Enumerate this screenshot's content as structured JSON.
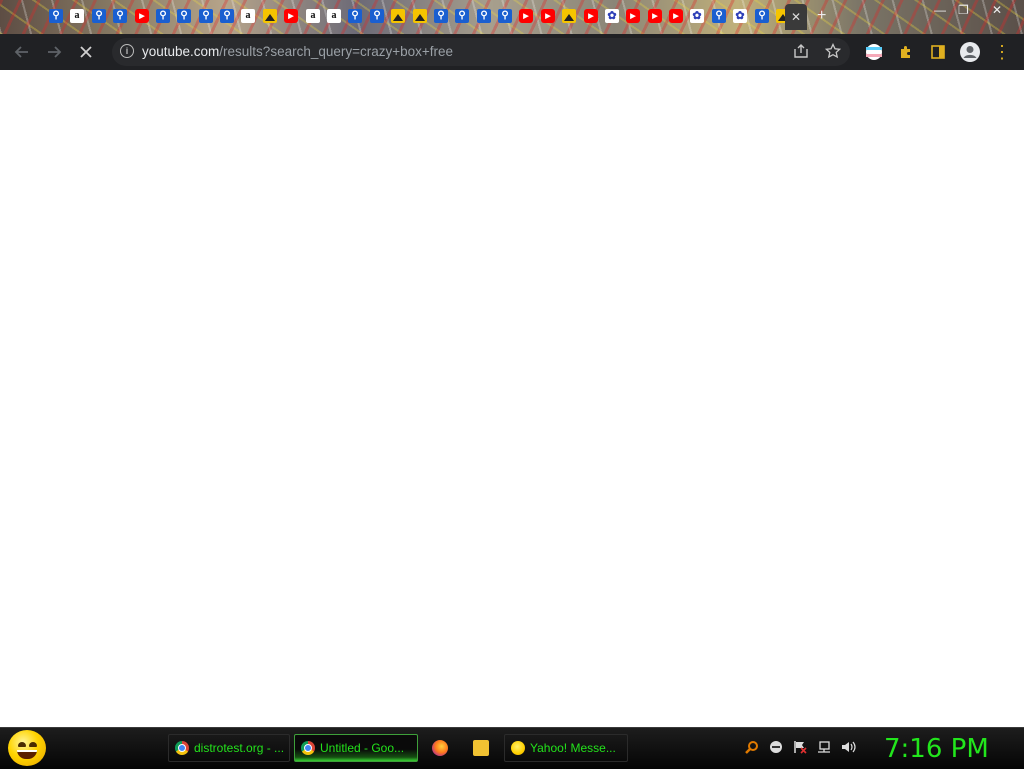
{
  "browser": {
    "url_host": "youtube.com",
    "url_path": "/results?search_query=crazy+box+free",
    "tabs": [
      {
        "icon": "search-icon"
      },
      {
        "icon": "amazon-icon",
        "glyph": "a"
      },
      {
        "icon": "search-icon"
      },
      {
        "icon": "search-icon"
      },
      {
        "icon": "youtube-icon"
      },
      {
        "icon": "search-icon"
      },
      {
        "icon": "search-icon"
      },
      {
        "icon": "search-icon"
      },
      {
        "icon": "search-icon"
      },
      {
        "icon": "amazon-icon",
        "glyph": "a"
      },
      {
        "icon": "image-icon"
      },
      {
        "icon": "youtube-icon"
      },
      {
        "icon": "amazon-icon",
        "glyph": "a"
      },
      {
        "icon": "amazon-icon",
        "glyph": "a"
      },
      {
        "icon": "search-icon"
      },
      {
        "icon": "search-icon"
      },
      {
        "icon": "image-icon"
      },
      {
        "icon": "image-icon"
      },
      {
        "icon": "search-icon"
      },
      {
        "icon": "search-icon"
      },
      {
        "icon": "search-icon"
      },
      {
        "icon": "search-icon"
      },
      {
        "icon": "youtube-icon"
      },
      {
        "icon": "youtube-icon"
      },
      {
        "icon": "image-icon"
      },
      {
        "icon": "youtube-icon"
      },
      {
        "icon": "paw-icon"
      },
      {
        "icon": "youtube-icon"
      },
      {
        "icon": "youtube-icon"
      },
      {
        "icon": "youtube-icon"
      },
      {
        "icon": "paw-icon"
      },
      {
        "icon": "search-icon"
      },
      {
        "icon": "paw-icon"
      },
      {
        "icon": "search-icon"
      },
      {
        "icon": "image-icon"
      }
    ]
  },
  "taskbar": {
    "tasks": [
      {
        "label": "distrotest.org - ...",
        "icon": "chrome-icon",
        "active": false
      },
      {
        "label": "Untitled - Goo...",
        "icon": "chrome-icon",
        "active": true
      },
      {
        "label": "Yahoo! Messe...",
        "icon": "yahoo-messenger-icon",
        "active": false
      }
    ],
    "clock": "7:16 PM"
  }
}
